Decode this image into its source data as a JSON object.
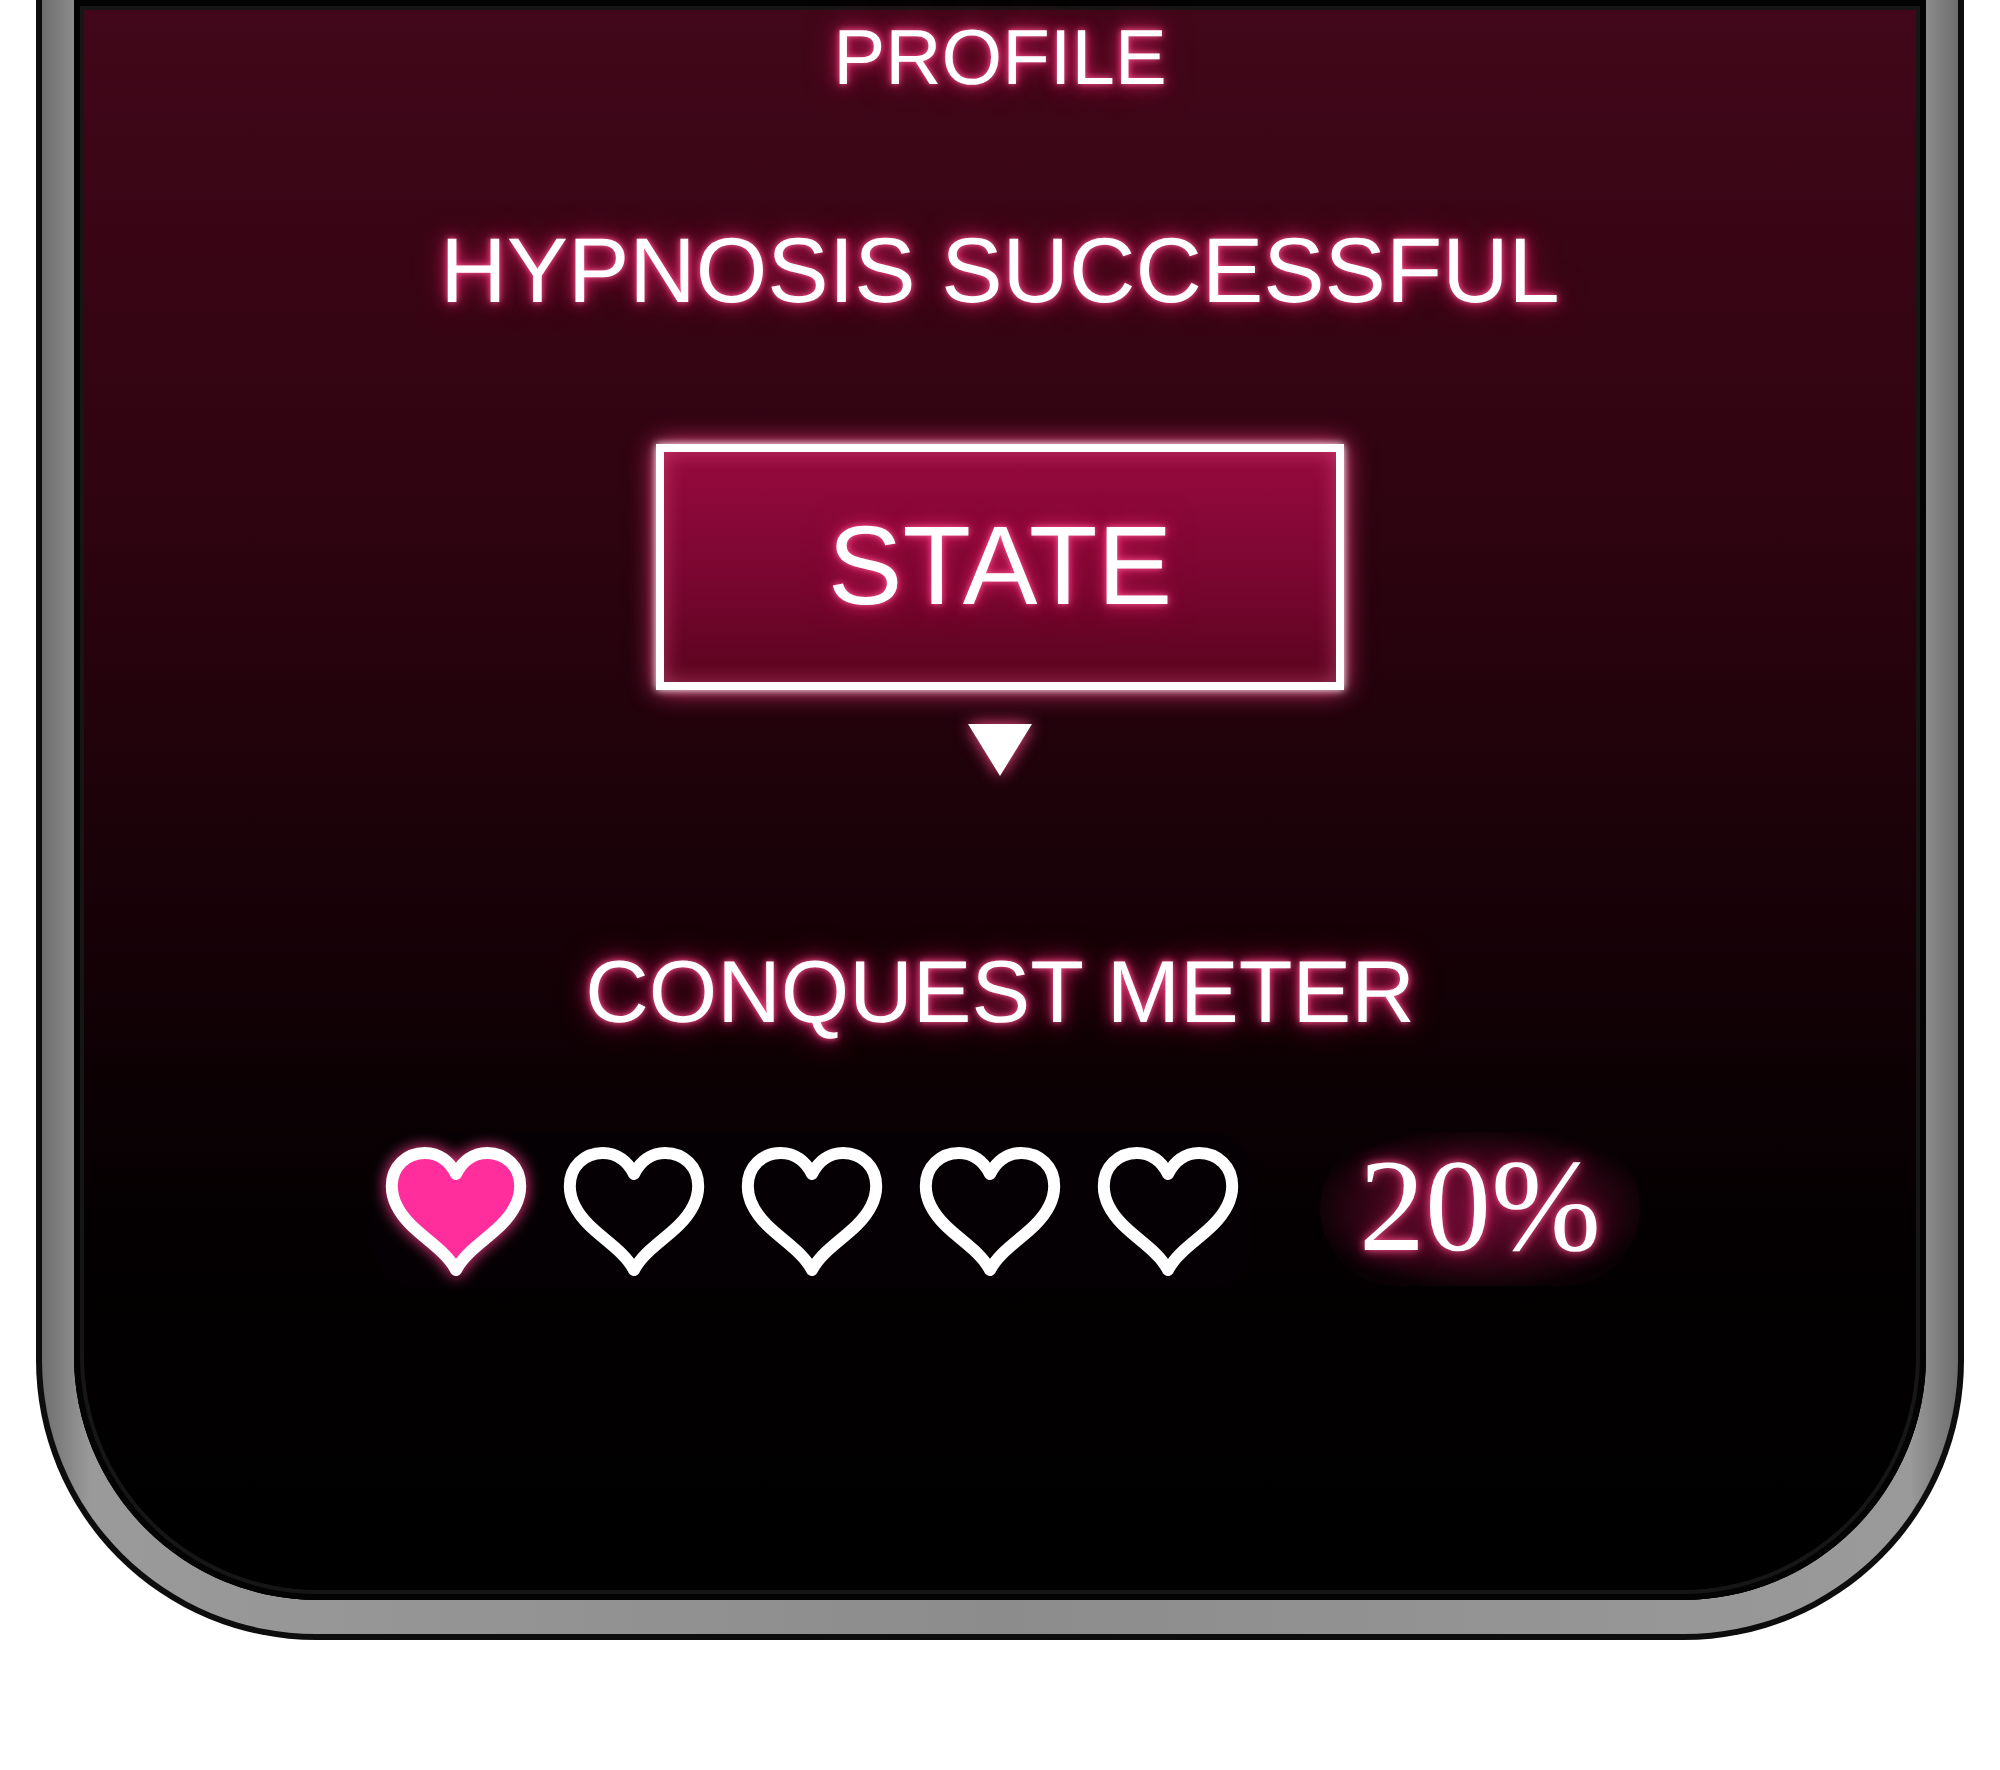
{
  "screen": {
    "title": "PROFILE",
    "status": "HYPNOSIS SUCCESSFUL",
    "state_button": {
      "label": "STATE"
    },
    "conquest_meter": {
      "title": "CONQUEST METER",
      "stars": 1,
      "reading": "20%"
    }
  }
}
